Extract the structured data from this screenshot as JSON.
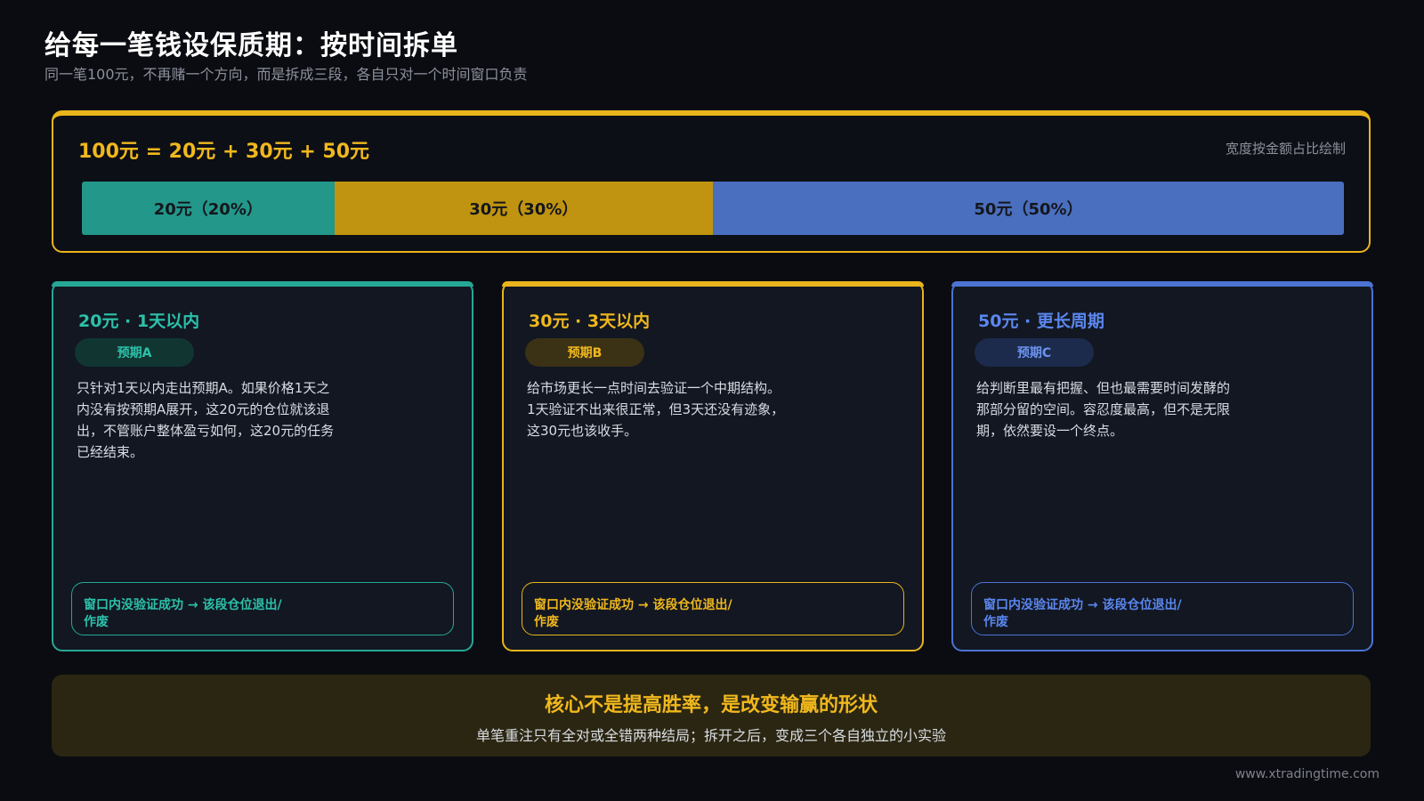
{
  "header": {
    "title": "给每一笔钱设保质期：按时间拆单",
    "subtitle": "同一笔100元，不再赌一个方向，而是拆成三段，各自只对一个时间窗口负责"
  },
  "allocation": {
    "equation": "100元 = 20元 + 30元 + 50元",
    "note": "宽度按金额占比绘制",
    "segments": [
      {
        "label": "20元（20%）",
        "percent": 20,
        "color": "#23978a"
      },
      {
        "label": "30元（30%）",
        "percent": 30,
        "color": "#c09410"
      },
      {
        "label": "50元（50%）",
        "percent": 50,
        "color": "#4a6fbf"
      }
    ]
  },
  "cards": [
    {
      "title": "20元 · 1天以内",
      "badge": "预期A",
      "body": "只针对1天以内走出预期A。如果价格1天之内没有按预期A展开，这20元的仓位就该退出，不管账户整体盈亏如何，这20元的任务已经结束。",
      "footer": "窗口内没验证成功 → 该段仓位退出/作废"
    },
    {
      "title": "30元 · 3天以内",
      "badge": "预期B",
      "body": "给市场更长一点时间去验证一个中期结构。1天验证不出来很正常，但3天还没有迹象，这30元也该收手。",
      "footer": "窗口内没验证成功 → 该段仓位退出/作废"
    },
    {
      "title": "50元 · 更长周期",
      "badge": "预期C",
      "body": "给判断里最有把握、但也最需要时间发酵的那部分留的空间。容忍度最高，但不是无限期，依然要设一个终点。",
      "footer": "窗口内没验证成功 → 该段仓位退出/作废"
    }
  ],
  "summary": {
    "headline": "核心不是提高胜率，是改变输赢的形状",
    "sub": "单笔重注只有全对或全错两种结局；拆开之后，变成三个各自独立的小实验"
  },
  "footer": {
    "url": "www.xtradingtime.com"
  }
}
